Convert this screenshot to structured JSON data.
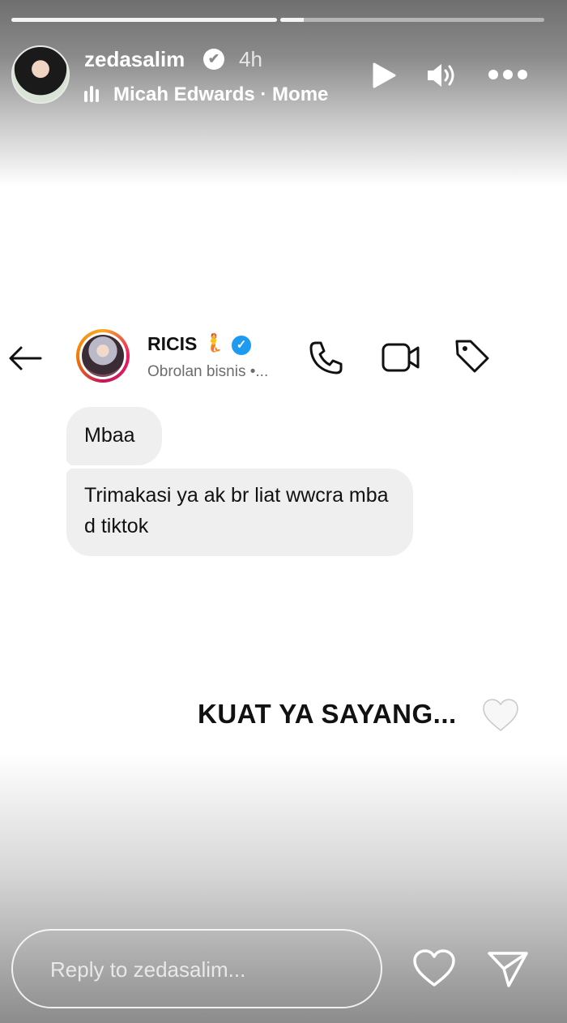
{
  "story": {
    "username": "zedasalim",
    "time_ago": "4h",
    "music": "Micah Edwards · Mome",
    "verified_icon": "check-badge-icon",
    "controls": [
      "play-icon",
      "volume-icon",
      "more-icon"
    ]
  },
  "chat": {
    "contact_name": "RICIS",
    "contact_emoji": "🧜",
    "contact_subtitle": "Obrolan bisnis •...",
    "verified_color": "#1d9bf0",
    "header_icons": [
      "back-arrow-icon",
      "phone-icon",
      "video-camera-icon",
      "tag-icon"
    ],
    "messages": [
      {
        "text": "Mbaa"
      },
      {
        "text": "Trimakasi ya ak br liat wwcra mba d tiktok"
      }
    ]
  },
  "caption": {
    "text": "KUAT YA SAYANG...",
    "emoji": "white-heart-icon"
  },
  "reply": {
    "placeholder": "Reply to zedasalim..."
  }
}
